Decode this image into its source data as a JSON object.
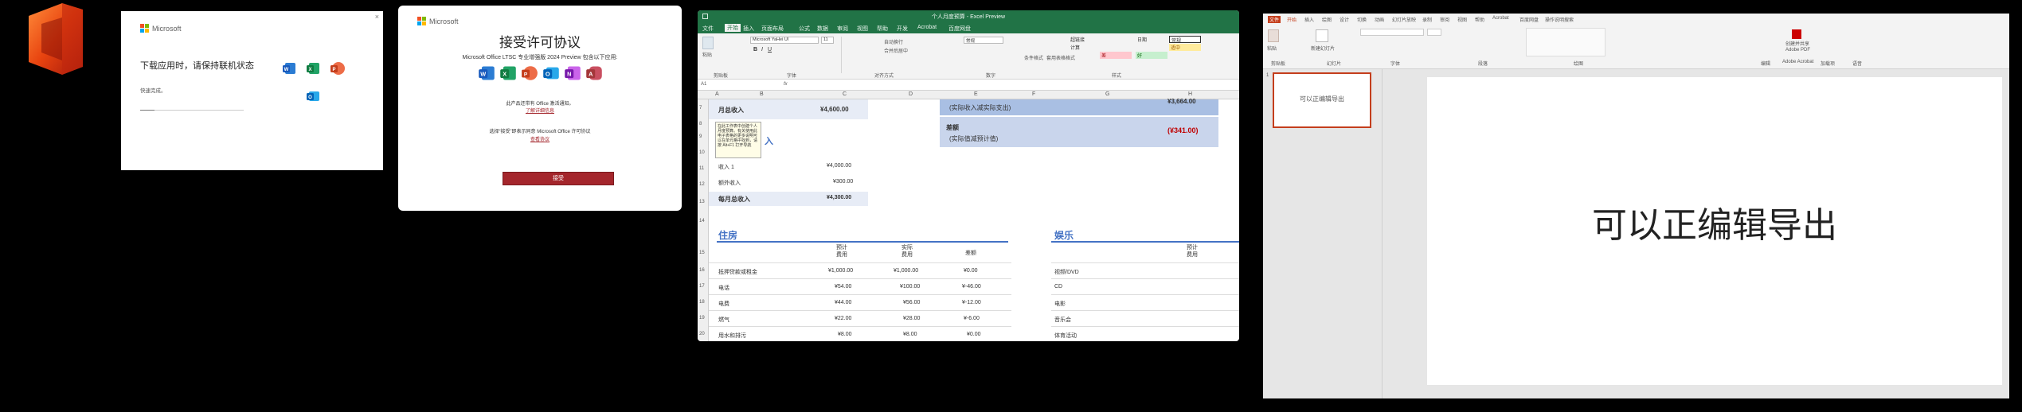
{
  "colors": {
    "excel_green": "#217346",
    "ppt_orange": "#c43e1c",
    "accent_red": "#a4262c",
    "ms_red": "#f25022",
    "ms_green": "#7fba00",
    "ms_blue": "#00a4ef",
    "ms_yellow": "#ffb900",
    "excel_header_blue": "#4472c4",
    "summary_fill": "#c9d5ec"
  },
  "install": {
    "brand": "Microsoft",
    "heading": "下载应用时，请保持联机状态",
    "status": "快速完成。",
    "close_label": "×"
  },
  "license": {
    "brand": "Microsoft",
    "title": "接受许可协议",
    "subtitle": "Microsoft Office LTSC 专业增强版 2024 Preview 包含以下应用:",
    "line1": "此产品还带有 Office 激活通知。",
    "link1": "了解详细信息",
    "line2": "选择“接受”即表示同意 Microsoft Office 许可协议",
    "link2": "查看协议",
    "accept_label": "接受"
  },
  "excel": {
    "title": "个人月度预算 - Excel Preview",
    "tabs": [
      "文件",
      "开始",
      "插入",
      "页面布局",
      "公式",
      "数据",
      "审阅",
      "视图",
      "帮助",
      "开发",
      "Acrobat",
      "百度网盘"
    ],
    "font_name": "Microsoft YaHei UI",
    "font_size": "11",
    "number_format": "常规",
    "paste_label": "粘贴",
    "clipboard_group": "剪贴板",
    "font_group": "字体",
    "alignment_group": "对齐方式",
    "number_group": "数字",
    "styles_group": "样式",
    "cond_format": "条件格式",
    "table_format": "套用表格格式",
    "wrap_label": "自动换行",
    "merge_label": "合并后居中",
    "style_cells": [
      "常规",
      "差",
      "好",
      "适中"
    ],
    "style_cells_2": [
      "超链接",
      "计算"
    ],
    "cell_ref": "A1",
    "fx": "fx",
    "columns": [
      "A",
      "B",
      "C",
      "D",
      "E",
      "F",
      "G",
      "H"
    ],
    "rows": [
      "6",
      "7",
      "8",
      "9",
      "10",
      "11",
      "12",
      "13",
      "14",
      "15",
      "16",
      "17",
      "18",
      "19",
      "20"
    ],
    "monthly_income_label": "月总收入",
    "monthly_income_value": "¥4,600.00",
    "tooltip": "在此工作表中创建个人月度预算。有关使用此电子表格的更多说明可以在单元格中找到，请按 Alt+F1 打开导航",
    "income_heading": "入",
    "income1_label": "收入 1",
    "income1_value": "¥4,000.00",
    "extra_label": "额外收入",
    "extra_value": "¥300.00",
    "total_label": "每月总收入",
    "total_value": "¥4,300.00",
    "summary_sub1": "(实际收入减实际支出)",
    "summary_top_value": "¥3,664.00",
    "diff_label": "差额",
    "diff_sub": "(实际值减预计值)",
    "diff_value": "(¥341.00)",
    "housing_title": "住房",
    "entertainment_title": "娱乐",
    "col_estimated": "预计\n费用",
    "col_actual": "实际\n费用",
    "col_diff": "差额",
    "housing_rows": [
      {
        "label": "抵押贷款或租金",
        "est": "¥1,000.00",
        "act": "¥1,000.00",
        "diff": "¥0.00"
      },
      {
        "label": "电话",
        "est": "¥54.00",
        "act": "¥100.00",
        "diff": "¥-46.00"
      },
      {
        "label": "电费",
        "est": "¥44.00",
        "act": "¥56.00",
        "diff": "¥-12.00"
      },
      {
        "label": "燃气",
        "est": "¥22.00",
        "act": "¥28.00",
        "diff": "¥-6.00"
      },
      {
        "label": "用水和排污",
        "est": "¥8.00",
        "act": "¥8.00",
        "diff": "¥0.00"
      }
    ],
    "entertainment_rows": [
      "视频/DVD",
      "CD",
      "电影",
      "音乐会",
      "体育活动"
    ]
  },
  "ppt": {
    "tabs": [
      "文件",
      "开始",
      "插入",
      "绘图",
      "设计",
      "切换",
      "动画",
      "幻灯片放映",
      "录制",
      "审阅",
      "视图",
      "帮助",
      "Acrobat",
      "百度网盘"
    ],
    "search_label": "操作说明搜索",
    "paste_label": "粘贴",
    "new_slide_label": "新建幻灯片",
    "ribbon_groups": [
      "剪贴板",
      "幻灯片",
      "字体",
      "段落",
      "绘图",
      "编辑",
      "Adobe Acrobat",
      "加载项",
      "语音"
    ],
    "acrobat_btn": "创建并共享 Adobe PDF",
    "slide_number": "1",
    "thumb_text": "可以正编辑导出",
    "slide_text": "可以正编辑导出"
  }
}
